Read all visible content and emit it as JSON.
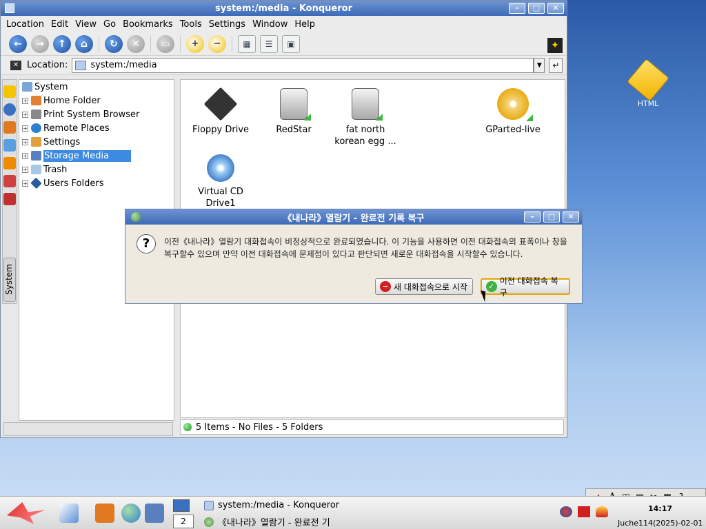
{
  "desktop": {
    "icon_label": "HTML"
  },
  "window": {
    "title": "system:/media - Konqueror",
    "menu": [
      "Location",
      "Edit",
      "View",
      "Go",
      "Bookmarks",
      "Tools",
      "Settings",
      "Window",
      "Help"
    ],
    "location_label": "Location:",
    "location_value": "system:/media"
  },
  "sidebar": {
    "tab_label": "System"
  },
  "tree": {
    "root": "System",
    "items": [
      "Home Folder",
      "Print System Browser",
      "Remote Places",
      "Settings",
      "Storage Media",
      "Trash",
      "Users Folders"
    ],
    "selected": "Storage Media"
  },
  "files": [
    {
      "name": "Floppy Drive",
      "name2": ""
    },
    {
      "name": "RedStar",
      "name2": ""
    },
    {
      "name": "fat north",
      "name2": "korean egg ..."
    },
    {
      "name": "GParted-live",
      "name2": ""
    },
    {
      "name": "Virtual CD",
      "name2": "Drive1"
    }
  ],
  "status": {
    "text": "5 Items - No Files - 5 Folders"
  },
  "dialog": {
    "title": "《내나라》열람기 - 완료전 기록 복구",
    "message": "이전《내나라》열람기 대화접속이 비정상적으로 완료되였습니다. 이 기능을 사용하면 이전 대화접속의 표폭이나 창을 복구할수 있으며 만약 이전 대화접속에 문제점이 있다고 판단되면 새로운 대화접속을 시작할수 있습니다.",
    "new_session_button": "새 대화접속으로 시작",
    "restore_button": "이전 대화접속 복구"
  },
  "taskbar": {
    "pager_number": "2",
    "tasks": [
      "system:/media - Konqueror",
      "《내나라》열람기 - 완료전 기"
    ],
    "clock": "14:17",
    "date": "Juche114(2025)-02-01"
  }
}
